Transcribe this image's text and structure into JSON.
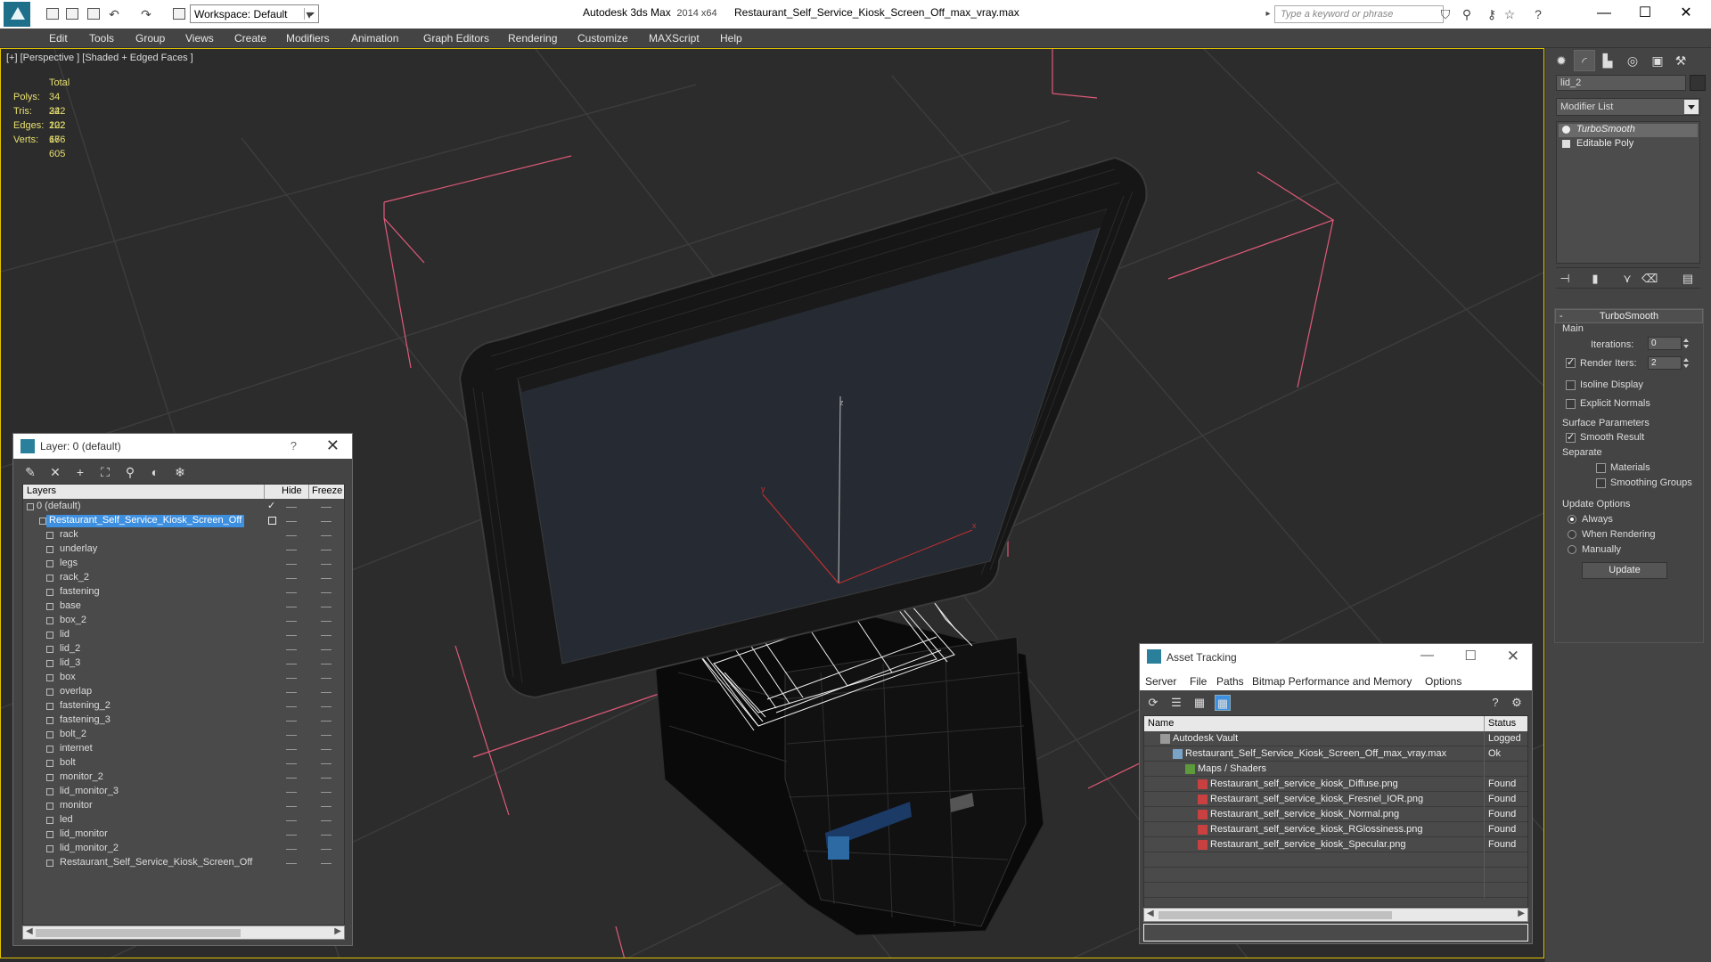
{
  "app": {
    "name": "Autodesk 3ds Max",
    "version": "2014 x64",
    "file": "Restaurant_Self_Service_Kiosk_Screen_Off_max_vray.max",
    "workspace": "Workspace: Default",
    "search_placeholder": "Type a keyword or phrase"
  },
  "menu": [
    "Edit",
    "Tools",
    "Group",
    "Views",
    "Create",
    "Modifiers",
    "Animation",
    "Graph Editors",
    "Rendering",
    "Customize",
    "MAXScript",
    "Help"
  ],
  "viewport": {
    "label": "[+] [Perspective ] [Shaded + Edged Faces ]",
    "stats_header": "Total",
    "stats": [
      {
        "key": "Polys:",
        "value": "34 222"
      },
      {
        "key": "Tris:",
        "value": "34 222"
      },
      {
        "key": "Edges:",
        "value": "102 666"
      },
      {
        "key": "Verts:",
        "value": "17 605"
      }
    ],
    "axis": {
      "z": "z",
      "y": "y",
      "x": "x"
    }
  },
  "command_panel": {
    "object_name": "lid_2",
    "modifier_list": "Modifier List",
    "stack": [
      "TurboSmooth",
      "Editable Poly"
    ],
    "turbosmooth": {
      "title": "TurboSmooth",
      "main": "Main",
      "iterations_label": "Iterations:",
      "iterations": "0",
      "render_iters_label": "Render Iters:",
      "render_iters": "2",
      "isoline": "Isoline Display",
      "explicit_normals": "Explicit Normals",
      "surface_params": "Surface Parameters",
      "smooth_result": "Smooth Result",
      "separate": "Separate",
      "materials": "Materials",
      "smoothing_groups": "Smoothing Groups",
      "update_options": "Update Options",
      "always": "Always",
      "when_rendering": "When Rendering",
      "manually": "Manually",
      "update_btn": "Update"
    }
  },
  "layer_dialog": {
    "title": "Layer: 0 (default)",
    "help": "?",
    "columns": [
      "Layers",
      "Hide",
      "Freeze"
    ],
    "default_layer": "0 (default)",
    "selected_layer": "Restaurant_Self_Service_Kiosk_Screen_Off",
    "objects": [
      "rack",
      "underlay",
      "legs",
      "rack_2",
      "fastening",
      "base",
      "box_2",
      "lid",
      "lid_2",
      "lid_3",
      "box",
      "overlap",
      "fastening_2",
      "fastening_3",
      "bolt_2",
      "internet",
      "bolt",
      "monitor_2",
      "lid_monitor_3",
      "monitor",
      "led",
      "lid_monitor",
      "lid_monitor_2",
      "Restaurant_Self_Service_Kiosk_Screen_Off"
    ]
  },
  "asset_tracking": {
    "title": "Asset Tracking",
    "menu": [
      "Server",
      "File",
      "Paths",
      "Bitmap Performance and Memory",
      "Options"
    ],
    "columns": [
      "Name",
      "Status"
    ],
    "rows": [
      {
        "name": "Autodesk Vault",
        "status": "Logged",
        "level": 0,
        "icon": "vault-icon"
      },
      {
        "name": "Restaurant_Self_Service_Kiosk_Screen_Off_max_vray.max",
        "status": "Ok",
        "level": 1,
        "icon": "max-file-icon"
      },
      {
        "name": "Maps / Shaders",
        "status": "",
        "level": 2,
        "icon": "maps-icon"
      },
      {
        "name": "Restaurant_self_service_kiosk_Diffuse.png",
        "status": "Found",
        "level": 3,
        "icon": "png-icon"
      },
      {
        "name": "Restaurant_self_service_kiosk_Fresnel_IOR.png",
        "status": "Found",
        "level": 3,
        "icon": "png-icon"
      },
      {
        "name": "Restaurant_self_service_kiosk_Normal.png",
        "status": "Found",
        "level": 3,
        "icon": "png-icon"
      },
      {
        "name": "Restaurant_self_service_kiosk_RGlossiness.png",
        "status": "Found",
        "level": 3,
        "icon": "png-icon"
      },
      {
        "name": "Restaurant_self_service_kiosk_Specular.png",
        "status": "Found",
        "level": 3,
        "icon": "png-icon"
      }
    ]
  },
  "colors": {
    "selection": "#3d8fe0",
    "stats_text": "#e8e070",
    "grid_line": "#3c3c3c",
    "bounding_box": "#e05a7a",
    "viewport_border": "#e2c400"
  }
}
